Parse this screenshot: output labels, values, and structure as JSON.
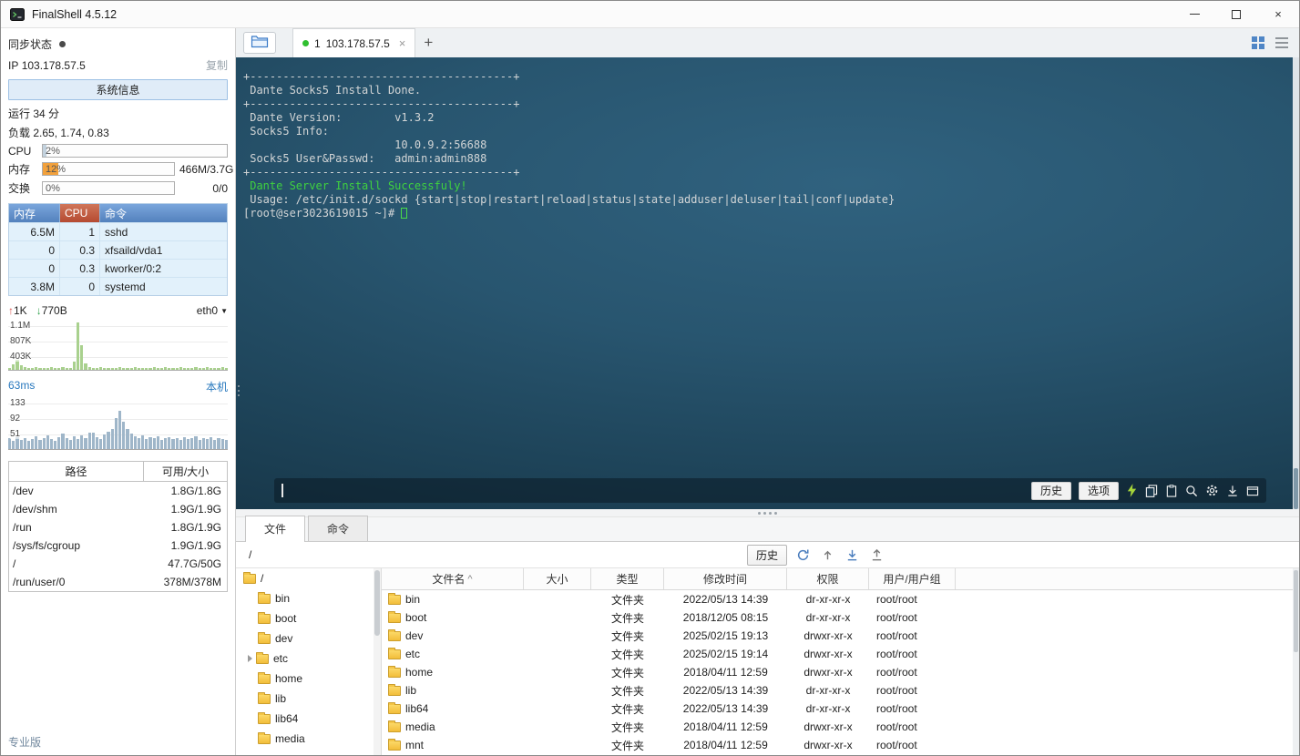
{
  "window": {
    "title": "FinalShell 4.5.12",
    "close_glyph": "×"
  },
  "sidebar": {
    "sync_label": "同步状态",
    "ip_label": "IP",
    "ip_value": "103.178.57.5",
    "copy_label": "复制",
    "system_info_button": "系统信息",
    "uptime": "运行 34 分",
    "load": "负载 2.65, 1.74, 0.83",
    "meters": [
      {
        "label": "CPU",
        "percent_text": "2%",
        "percent": 2,
        "value": "",
        "fill": "#c3d2de"
      },
      {
        "label": "内存",
        "percent_text": "12%",
        "percent": 12,
        "value": "466M/3.7G",
        "fill": "#f2a13c"
      },
      {
        "label": "交换",
        "percent_text": "0%",
        "percent": 0,
        "value": "0/0",
        "fill": "#c3d2de"
      }
    ],
    "process_table": {
      "headers": [
        "内存",
        "CPU",
        "命令"
      ],
      "rows": [
        [
          "6.5M",
          "1",
          "sshd"
        ],
        [
          "0",
          "0.3",
          "xfsaild/vda1"
        ],
        [
          "0",
          "0.3",
          "kworker/0:2"
        ],
        [
          "3.8M",
          "0",
          "systemd"
        ]
      ]
    },
    "network": {
      "up_arrow": "↑",
      "up_value": "1K",
      "down_arrow": "↓",
      "down_value": "770B",
      "interface": "eth0",
      "caret": "▼",
      "scale_labels": [
        "1.1M",
        "807K",
        "403K"
      ],
      "bars": [
        2,
        6,
        11,
        5,
        3,
        2,
        2,
        3,
        2,
        2,
        2,
        3,
        2,
        2,
        3,
        2,
        2,
        9,
        52,
        27,
        7,
        3,
        2,
        2,
        3,
        2,
        2,
        2,
        2,
        3,
        2,
        2,
        2,
        3,
        2,
        2,
        2,
        2,
        3,
        2,
        2,
        3,
        2,
        2,
        2,
        3,
        2,
        2,
        2,
        3,
        2,
        2,
        3,
        2,
        2,
        2,
        3,
        2
      ]
    },
    "ping": {
      "latency": "63ms",
      "target": "本机",
      "scale_labels": [
        "133",
        "92",
        "51"
      ],
      "bars": [
        12,
        9,
        13,
        10,
        12,
        9,
        11,
        14,
        10,
        12,
        15,
        11,
        9,
        13,
        17,
        12,
        10,
        14,
        11,
        15,
        12,
        18,
        18,
        13,
        11,
        16,
        19,
        22,
        34,
        42,
        30,
        22,
        17,
        14,
        12,
        15,
        11,
        13,
        12,
        14,
        10,
        12,
        13,
        11,
        12,
        10,
        13,
        11,
        12,
        14,
        10,
        12,
        11,
        13,
        10,
        12,
        11,
        10
      ]
    },
    "disk_table": {
      "headers": [
        "路径",
        "可用/大小"
      ],
      "rows": [
        [
          "/dev",
          "1.8G/1.8G"
        ],
        [
          "/dev/shm",
          "1.9G/1.9G"
        ],
        [
          "/run",
          "1.8G/1.9G"
        ],
        [
          "/sys/fs/cgroup",
          "1.9G/1.9G"
        ],
        [
          "/",
          "47.7G/50G"
        ],
        [
          "/run/user/0",
          "378M/378M"
        ]
      ]
    },
    "edition": "专业版"
  },
  "tabbar": {
    "tab_index": "1",
    "tab_label": "103.178.57.5",
    "close": "×",
    "new_tab": "+"
  },
  "terminal": {
    "lines": [
      {
        "text": "+----------------------------------------+"
      },
      {
        "text": " Dante Socks5 Install Done."
      },
      {
        "text": "+----------------------------------------+"
      },
      {
        "text": " Dante Version:        v1.3.2"
      },
      {
        "text": " Socks5 Info:"
      },
      {
        "text": "                       10.0.9.2:56688"
      },
      {
        "text": " Socks5 User&Passwd:   admin:admin888"
      },
      {
        "text": "+----------------------------------------+"
      },
      {
        "text": " Dante Server Install Successfuly!",
        "color": "green"
      },
      {
        "text": ""
      },
      {
        "text": " Usage: /etc/init.d/sockd {start|stop|restart|reload|status|state|adduser|deluser|tail|conf|update}"
      },
      {
        "text": "[root@ser3023619015 ~]# ",
        "cursor": true
      }
    ],
    "toolbar": {
      "history": "历史",
      "options": "选项"
    }
  },
  "file_panel": {
    "tabs": [
      {
        "label": "文件"
      },
      {
        "label": "命令"
      }
    ],
    "path": "/",
    "history_button": "历史",
    "tree": [
      {
        "label": "/",
        "depth": 0
      },
      {
        "label": "bin",
        "depth": 1
      },
      {
        "label": "boot",
        "depth": 1
      },
      {
        "label": "dev",
        "depth": 1
      },
      {
        "label": "etc",
        "depth": 1,
        "expandable": true
      },
      {
        "label": "home",
        "depth": 1
      },
      {
        "label": "lib",
        "depth": 1
      },
      {
        "label": "lib64",
        "depth": 1
      },
      {
        "label": "media",
        "depth": 1
      }
    ],
    "table": {
      "headers": [
        "文件名",
        "大小",
        "类型",
        "修改时间",
        "权限",
        "用户/用户组"
      ],
      "sort_indicator": "^",
      "rows": [
        {
          "name": "bin",
          "size": "",
          "type": "文件夹",
          "mtime": "2022/05/13 14:39",
          "perm": "dr-xr-xr-x",
          "owner": "root/root"
        },
        {
          "name": "boot",
          "size": "",
          "type": "文件夹",
          "mtime": "2018/12/05 08:15",
          "perm": "dr-xr-xr-x",
          "owner": "root/root"
        },
        {
          "name": "dev",
          "size": "",
          "type": "文件夹",
          "mtime": "2025/02/15 19:13",
          "perm": "drwxr-xr-x",
          "owner": "root/root"
        },
        {
          "name": "etc",
          "size": "",
          "type": "文件夹",
          "mtime": "2025/02/15 19:14",
          "perm": "drwxr-xr-x",
          "owner": "root/root"
        },
        {
          "name": "home",
          "size": "",
          "type": "文件夹",
          "mtime": "2018/04/11 12:59",
          "perm": "drwxr-xr-x",
          "owner": "root/root"
        },
        {
          "name": "lib",
          "size": "",
          "type": "文件夹",
          "mtime": "2022/05/13 14:39",
          "perm": "dr-xr-xr-x",
          "owner": "root/root"
        },
        {
          "name": "lib64",
          "size": "",
          "type": "文件夹",
          "mtime": "2022/05/13 14:39",
          "perm": "dr-xr-xr-x",
          "owner": "root/root"
        },
        {
          "name": "media",
          "size": "",
          "type": "文件夹",
          "mtime": "2018/04/11 12:59",
          "perm": "drwxr-xr-x",
          "owner": "root/root"
        },
        {
          "name": "mnt",
          "size": "",
          "type": "文件夹",
          "mtime": "2018/04/11 12:59",
          "perm": "drwxr-xr-x",
          "owner": "root/root"
        }
      ]
    }
  }
}
